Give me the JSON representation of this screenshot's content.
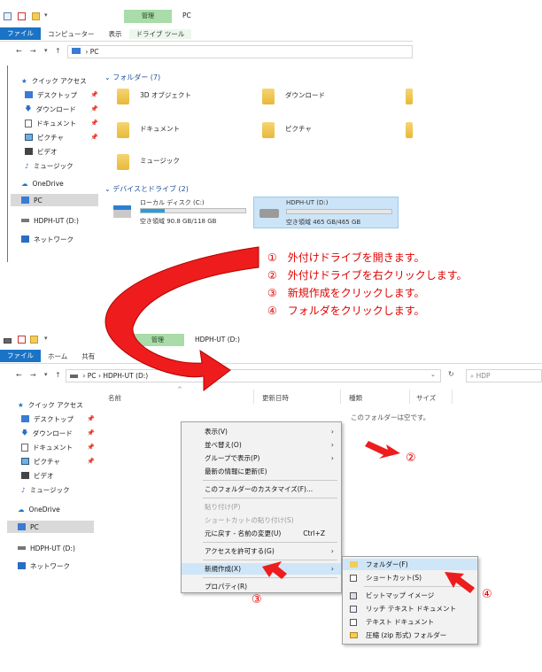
{
  "top_window": {
    "ribbon": {
      "manage_tab": "管理",
      "title": "PC",
      "tabs": [
        "ファイル",
        "コンピューター",
        "表示"
      ],
      "contextual_tab": "ドライブ ツール"
    },
    "address": "PC",
    "nav": {
      "quick_access": "クイック アクセス",
      "items": [
        "デスクトップ",
        "ダウンロード",
        "ドキュメント",
        "ピクチャ",
        "ビデオ",
        "ミュージック"
      ],
      "onedrive": "OneDrive",
      "pc": "PC",
      "drive": "HDPH-UT (D:)",
      "network": "ネットワーク"
    },
    "folders_header": "フォルダー (7)",
    "folders": [
      "3D オブジェクト",
      "ダウンロード",
      "ドキュメント",
      "ピクチャ",
      "ミュージック"
    ],
    "devices_header": "デバイスとドライブ (2)",
    "drives": [
      {
        "name": "ローカル ディスク (C:)",
        "free": "空き領域 90.8 GB/118 GB",
        "used_fraction": 0.23
      },
      {
        "name": "HDPH-UT (D:)",
        "free": "空き領域 465 GB/465 GB",
        "used_fraction": 0.0
      }
    ]
  },
  "instructions": [
    "①　外付けドライブを開きます。",
    "②　外付けドライブを右クリックします。",
    "③　新規作成をクリックします。",
    "④　フォルダをクリックします。"
  ],
  "bottom_window": {
    "ribbon": {
      "manage_tab": "管理",
      "title": "HDPH-UT (D:)",
      "tabs": [
        "ファイル",
        "ホーム",
        "共有"
      ]
    },
    "address": [
      "PC",
      "HDPH-UT (D:)"
    ],
    "search_placeholder": "HDP",
    "columns": [
      "名前",
      "更新日時",
      "種類",
      "サイズ"
    ],
    "empty_text": "このフォルダーは空です。",
    "nav": {
      "quick_access": "クイック アクセス",
      "items": [
        "デスクトップ",
        "ダウンロード",
        "ドキュメント",
        "ピクチャ",
        "ビデオ",
        "ミュージック"
      ],
      "onedrive": "OneDrive",
      "pc": "PC",
      "drive": "HDPH-UT (D:)",
      "network": "ネットワーク"
    },
    "context_menu": [
      "表示(V)",
      "並べ替え(O)",
      "グループで表示(P)",
      "最新の情報に更新(E)",
      "このフォルダーのカスタマイズ(F)...",
      "貼り付け(P)",
      "ショートカットの貼り付け(S)",
      "元に戻す - 名前の変更(U)",
      "アクセスを許可する(G)",
      "新規作成(X)",
      "プロパティ(R)"
    ],
    "undo_shortcut": "Ctrl+Z",
    "submenu": [
      "フォルダー(F)",
      "ショートカット(S)",
      "ビットマップ イメージ",
      "リッチ テキスト ドキュメント",
      "テキスト ドキュメント",
      "圧縮 (zip 形式) フォルダー"
    ]
  },
  "markers": [
    "②",
    "③",
    "④"
  ],
  "colors": {
    "accent": "#1a73c6",
    "annotation": "#e00000",
    "manage_tab": "#a9dca9",
    "selection": "#cce4f7"
  }
}
